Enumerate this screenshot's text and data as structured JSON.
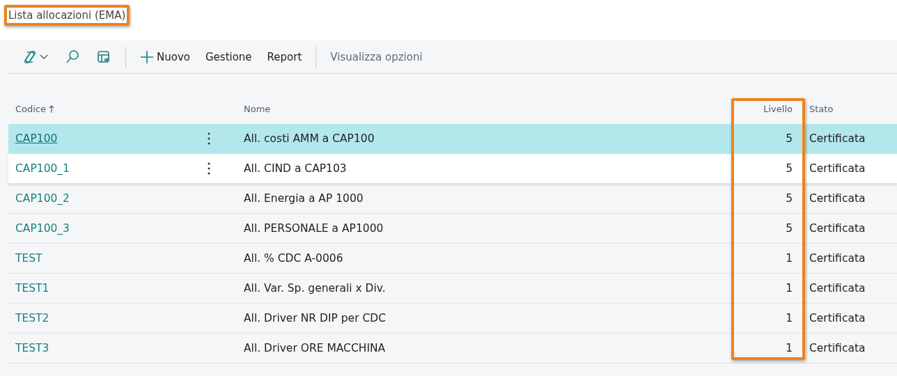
{
  "page": {
    "title": "Lista allocazioni (EMA)",
    "title_highlighted": true
  },
  "toolbar": {
    "actions": [
      {
        "kind": "icon",
        "dropdown": true
      },
      {
        "kind": "icon",
        "dropdown": false
      },
      {
        "kind": "icon",
        "dropdown": false
      },
      {
        "kind": "separator"
      },
      {
        "kind": "add",
        "label": "Nuovo"
      },
      {
        "kind": "text",
        "label": "Gestione"
      },
      {
        "kind": "text",
        "label": "Report"
      },
      {
        "kind": "separator"
      },
      {
        "kind": "muted",
        "label": "Visualizza opzioni"
      }
    ]
  },
  "table": {
    "columns": [
      {
        "label": "Codice",
        "sorted": true,
        "highlighted": false
      },
      {
        "label": "Nome",
        "sorted": false,
        "highlighted": false
      },
      {
        "label": "Livello",
        "sorted": false,
        "highlighted": true
      },
      {
        "label": "Stato",
        "sorted": false,
        "highlighted": false
      }
    ],
    "rows": [
      {
        "code": "CAP100",
        "name": "All. costi AMM a CAP100",
        "level": "5",
        "status": "Certificata",
        "selected": true,
        "hovered": false
      },
      {
        "code": "CAP100_1",
        "name": "All. CIND a CAP103",
        "level": "5",
        "status": "Certificata",
        "selected": false,
        "hovered": true
      },
      {
        "code": "CAP100_2",
        "name": "All. Energia a AP 1000",
        "level": "5",
        "status": "Certificata",
        "selected": false,
        "hovered": false
      },
      {
        "code": "CAP100_3",
        "name": "All. PERSONALE a AP1000",
        "level": "5",
        "status": "Certificata",
        "selected": false,
        "hovered": false
      },
      {
        "code": "TEST",
        "name": "All. % CDC A-0006",
        "level": "1",
        "status": "Certificata",
        "selected": false,
        "hovered": false
      },
      {
        "code": "TEST1",
        "name": "All. Var. Sp. generali x Div.",
        "level": "1",
        "status": "Certificata",
        "selected": false,
        "hovered": false
      },
      {
        "code": "TEST2",
        "name": "All. Driver NR DIP per CDC",
        "level": "1",
        "status": "Certificata",
        "selected": false,
        "hovered": false
      },
      {
        "code": "TEST3",
        "name": "All. Driver ORE MACCHINA",
        "level": "1",
        "status": "Certificata",
        "selected": false,
        "hovered": false
      }
    ]
  }
}
